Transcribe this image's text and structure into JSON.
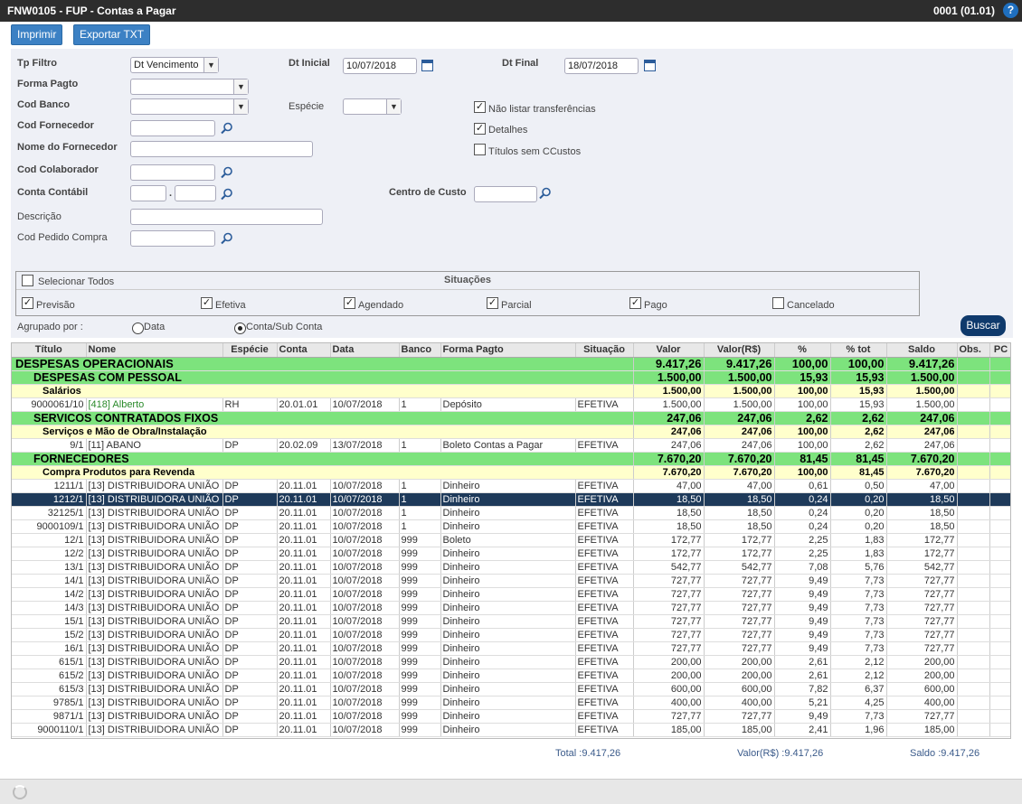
{
  "window": {
    "title": "FNW0105 - FUP - Contas a Pagar",
    "company": "0001 (01.01)"
  },
  "toolbar": {
    "print_label": "Imprimir",
    "export_label": "Exportar TXT"
  },
  "form": {
    "tp_filtro_label": "Tp Filtro",
    "tp_filtro_value": "Dt Vencimento",
    "dt_inicial_label": "Dt Inicial",
    "dt_inicial_value": "10/07/2018",
    "dt_final_label": "Dt Final",
    "dt_final_value": "18/07/2018",
    "forma_pagto_label": "Forma Pagto",
    "cod_banco_label": "Cod Banco",
    "especie_label": "Espécie",
    "cod_fornecedor_label": "Cod Fornecedor",
    "nome_fornecedor_label": "Nome do Fornecedor",
    "cod_colaborador_label": "Cod Colaborador",
    "conta_contabil_label": "Conta Contábil",
    "centro_custo_label": "Centro de Custo",
    "descricao_label": "Descrição",
    "cod_pedido_label": "Cod Pedido Compra",
    "nao_listar_label": "Não listar transferências",
    "detalhes_label": "Detalhes",
    "titulos_sem_label": "Títulos sem CCustos"
  },
  "situacoes": {
    "title": "Situações",
    "select_all": "Selecionar Todos",
    "items": [
      "Previsão",
      "Efetiva",
      "Agendado",
      "Parcial",
      "Pago",
      "Cancelado"
    ]
  },
  "grouping": {
    "label": "Agrupado por :",
    "opt1": "Data",
    "opt2": "Conta/Sub Conta",
    "selected": "Conta/Sub Conta"
  },
  "search_label": "Buscar",
  "grid": {
    "headers": [
      "Título",
      "Nome",
      "Espécie",
      "Conta",
      "Data",
      "Banco",
      "Forma Pagto",
      "Situação",
      "Valor",
      "Valor(R$)",
      "%",
      "% tot",
      "Saldo",
      "Obs.",
      "PC"
    ],
    "rows": [
      {
        "t": "g0",
        "title": "DESPESAS OPERACIONAIS",
        "v": "9.417,26",
        "vr": "9.417,26",
        "p": "100,00",
        "pt": "100,00",
        "s": "9.417,26"
      },
      {
        "t": "g1",
        "title": "DESPESAS COM PESSOAL",
        "v": "1.500,00",
        "vr": "1.500,00",
        "p": "15,93",
        "pt": "15,93",
        "s": "1.500,00"
      },
      {
        "t": "g2",
        "title": "Salários",
        "v": "1.500,00",
        "vr": "1.500,00",
        "p": "100,00",
        "pt": "15,93",
        "s": "1.500,00"
      },
      {
        "t": "d",
        "c": [
          "9000061/10",
          "[418] Alberto",
          "RH",
          "20.01.01",
          "10/07/2018",
          "1",
          "Depósito",
          "EFETIVA",
          "1.500,00",
          "1.500,00",
          "100,00",
          "15,93",
          "1.500,00",
          "",
          ""
        ]
      },
      {
        "t": "g1",
        "title": "SERVICOS CONTRATADOS FIXOS",
        "v": "247,06",
        "vr": "247,06",
        "p": "2,62",
        "pt": "2,62",
        "s": "247,06"
      },
      {
        "t": "g2",
        "title": "Serviços e Mão de Obra/Instalação",
        "v": "247,06",
        "vr": "247,06",
        "p": "100,00",
        "pt": "2,62",
        "s": "247,06"
      },
      {
        "t": "d",
        "c": [
          "9/1",
          "[11] ABANO",
          "DP",
          "20.02.09",
          "13/07/2018",
          "1",
          "Boleto Contas a Pagar",
          "EFETIVA",
          "247,06",
          "247,06",
          "100,00",
          "2,62",
          "247,06",
          "",
          ""
        ]
      },
      {
        "t": "g1",
        "title": "FORNECEDORES",
        "v": "7.670,20",
        "vr": "7.670,20",
        "p": "81,45",
        "pt": "81,45",
        "s": "7.670,20"
      },
      {
        "t": "g2",
        "title": "Compra Produtos para Revenda",
        "v": "7.670,20",
        "vr": "7.670,20",
        "p": "100,00",
        "pt": "81,45",
        "s": "7.670,20"
      },
      {
        "t": "d",
        "c": [
          "1211/1",
          "[13] DISTRIBUIDORA UNIÃO",
          "DP",
          "20.11.01",
          "10/07/2018",
          "1",
          "Dinheiro",
          "EFETIVA",
          "47,00",
          "47,00",
          "0,61",
          "0,50",
          "47,00",
          "",
          ""
        ]
      },
      {
        "t": "ds",
        "c": [
          "1212/1",
          "[13] DISTRIBUIDORA UNIÃO",
          "DP",
          "20.11.01",
          "10/07/2018",
          "1",
          "Dinheiro",
          "EFETIVA",
          "18,50",
          "18,50",
          "0,24",
          "0,20",
          "18,50",
          "",
          ""
        ]
      },
      {
        "t": "d",
        "c": [
          "32125/1",
          "[13] DISTRIBUIDORA UNIÃO",
          "DP",
          "20.11.01",
          "10/07/2018",
          "1",
          "Dinheiro",
          "EFETIVA",
          "18,50",
          "18,50",
          "0,24",
          "0,20",
          "18,50",
          "",
          ""
        ]
      },
      {
        "t": "d",
        "c": [
          "9000109/1",
          "[13] DISTRIBUIDORA UNIÃO",
          "DP",
          "20.11.01",
          "10/07/2018",
          "1",
          "Dinheiro",
          "EFETIVA",
          "18,50",
          "18,50",
          "0,24",
          "0,20",
          "18,50",
          "",
          ""
        ]
      },
      {
        "t": "d",
        "c": [
          "12/1",
          "[13] DISTRIBUIDORA UNIÃO",
          "DP",
          "20.11.01",
          "10/07/2018",
          "999",
          "Boleto",
          "EFETIVA",
          "172,77",
          "172,77",
          "2,25",
          "1,83",
          "172,77",
          "",
          ""
        ]
      },
      {
        "t": "d",
        "c": [
          "12/2",
          "[13] DISTRIBUIDORA UNIÃO",
          "DP",
          "20.11.01",
          "10/07/2018",
          "999",
          "Dinheiro",
          "EFETIVA",
          "172,77",
          "172,77",
          "2,25",
          "1,83",
          "172,77",
          "",
          ""
        ]
      },
      {
        "t": "d",
        "c": [
          "13/1",
          "[13] DISTRIBUIDORA UNIÃO",
          "DP",
          "20.11.01",
          "10/07/2018",
          "999",
          "Dinheiro",
          "EFETIVA",
          "542,77",
          "542,77",
          "7,08",
          "5,76",
          "542,77",
          "",
          ""
        ]
      },
      {
        "t": "d",
        "c": [
          "14/1",
          "[13] DISTRIBUIDORA UNIÃO",
          "DP",
          "20.11.01",
          "10/07/2018",
          "999",
          "Dinheiro",
          "EFETIVA",
          "727,77",
          "727,77",
          "9,49",
          "7,73",
          "727,77",
          "",
          ""
        ]
      },
      {
        "t": "d",
        "c": [
          "14/2",
          "[13] DISTRIBUIDORA UNIÃO",
          "DP",
          "20.11.01",
          "10/07/2018",
          "999",
          "Dinheiro",
          "EFETIVA",
          "727,77",
          "727,77",
          "9,49",
          "7,73",
          "727,77",
          "",
          ""
        ]
      },
      {
        "t": "d",
        "c": [
          "14/3",
          "[13] DISTRIBUIDORA UNIÃO",
          "DP",
          "20.11.01",
          "10/07/2018",
          "999",
          "Dinheiro",
          "EFETIVA",
          "727,77",
          "727,77",
          "9,49",
          "7,73",
          "727,77",
          "",
          ""
        ]
      },
      {
        "t": "d",
        "c": [
          "15/1",
          "[13] DISTRIBUIDORA UNIÃO",
          "DP",
          "20.11.01",
          "10/07/2018",
          "999",
          "Dinheiro",
          "EFETIVA",
          "727,77",
          "727,77",
          "9,49",
          "7,73",
          "727,77",
          "",
          ""
        ]
      },
      {
        "t": "d",
        "c": [
          "15/2",
          "[13] DISTRIBUIDORA UNIÃO",
          "DP",
          "20.11.01",
          "10/07/2018",
          "999",
          "Dinheiro",
          "EFETIVA",
          "727,77",
          "727,77",
          "9,49",
          "7,73",
          "727,77",
          "",
          ""
        ]
      },
      {
        "t": "d",
        "c": [
          "16/1",
          "[13] DISTRIBUIDORA UNIÃO",
          "DP",
          "20.11.01",
          "10/07/2018",
          "999",
          "Dinheiro",
          "EFETIVA",
          "727,77",
          "727,77",
          "9,49",
          "7,73",
          "727,77",
          "",
          ""
        ]
      },
      {
        "t": "d",
        "c": [
          "615/1",
          "[13] DISTRIBUIDORA UNIÃO",
          "DP",
          "20.11.01",
          "10/07/2018",
          "999",
          "Dinheiro",
          "EFETIVA",
          "200,00",
          "200,00",
          "2,61",
          "2,12",
          "200,00",
          "",
          ""
        ]
      },
      {
        "t": "d",
        "c": [
          "615/2",
          "[13] DISTRIBUIDORA UNIÃO",
          "DP",
          "20.11.01",
          "10/07/2018",
          "999",
          "Dinheiro",
          "EFETIVA",
          "200,00",
          "200,00",
          "2,61",
          "2,12",
          "200,00",
          "",
          ""
        ]
      },
      {
        "t": "d",
        "c": [
          "615/3",
          "[13] DISTRIBUIDORA UNIÃO",
          "DP",
          "20.11.01",
          "10/07/2018",
          "999",
          "Dinheiro",
          "EFETIVA",
          "600,00",
          "600,00",
          "7,82",
          "6,37",
          "600,00",
          "",
          ""
        ]
      },
      {
        "t": "d",
        "c": [
          "9785/1",
          "[13] DISTRIBUIDORA UNIÃO",
          "DP",
          "20.11.01",
          "10/07/2018",
          "999",
          "Dinheiro",
          "EFETIVA",
          "400,00",
          "400,00",
          "5,21",
          "4,25",
          "400,00",
          "",
          ""
        ]
      },
      {
        "t": "d",
        "c": [
          "9871/1",
          "[13] DISTRIBUIDORA UNIÃO",
          "DP",
          "20.11.01",
          "10/07/2018",
          "999",
          "Dinheiro",
          "EFETIVA",
          "727,77",
          "727,77",
          "9,49",
          "7,73",
          "727,77",
          "",
          ""
        ]
      },
      {
        "t": "d",
        "c": [
          "9000110/1",
          "[13] DISTRIBUIDORA UNIÃO",
          "DP",
          "20.11.01",
          "10/07/2018",
          "999",
          "Dinheiro",
          "EFETIVA",
          "185,00",
          "185,00",
          "2,41",
          "1,96",
          "185,00",
          "",
          ""
        ]
      }
    ]
  },
  "totals": {
    "total": "Total :9.417,26",
    "valor": "Valor(R$) :9.417,26",
    "saldo": "Saldo :9.417,26"
  },
  "colors": {
    "group_green": "#7de37d",
    "subgroup_yellow": "#ffffcc",
    "selected_row": "#1e3a5a",
    "button_blue": "#3c81c4",
    "name_link_green": "#2a8a2a"
  }
}
